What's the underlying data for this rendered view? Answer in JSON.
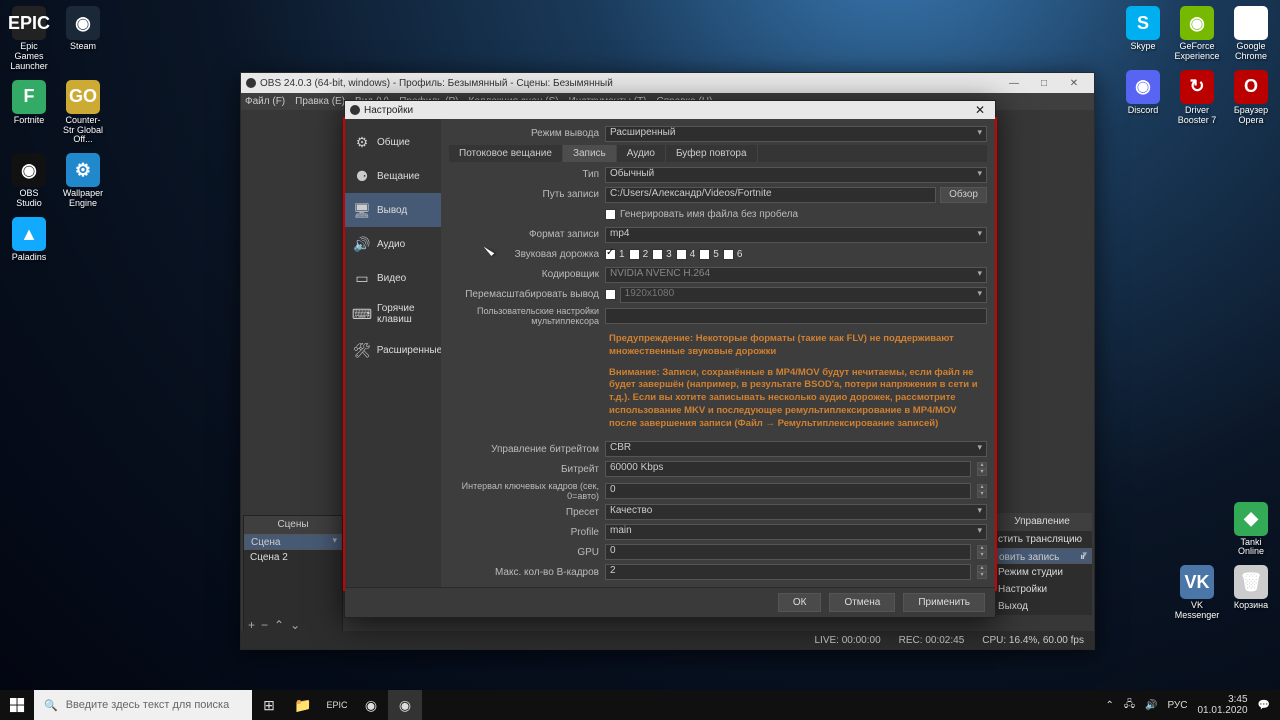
{
  "desktop": {
    "left": [
      [
        {
          "label": "Epic Games Launcher",
          "color": "#222",
          "text": "EPIC"
        },
        {
          "label": "Steam",
          "color": "#1b2838",
          "text": "◉"
        }
      ],
      [
        {
          "label": "Fortnite",
          "color": "#3a6",
          "text": "F"
        },
        {
          "label": "Counter-Str Global Off...",
          "color": "#ca3",
          "text": "GO"
        }
      ],
      [
        {
          "label": "OBS Studio",
          "color": "#111",
          "text": "◉"
        },
        {
          "label": "Wallpaper Engine",
          "color": "#28c",
          "text": "⚙"
        }
      ],
      [
        {
          "label": "Paladins",
          "color": "#1af",
          "text": "▲"
        }
      ]
    ],
    "right": [
      [
        {
          "label": "Skype",
          "color": "#00aff0",
          "text": "S"
        },
        {
          "label": "GeForce Experience",
          "color": "#76b900",
          "text": "◉"
        },
        {
          "label": "Google Chrome",
          "color": "#fff",
          "text": "◉"
        }
      ],
      [
        {
          "label": "Discord",
          "color": "#5865f2",
          "text": "◉"
        },
        {
          "label": "Driver Booster 7",
          "color": "#b00",
          "text": "↻"
        },
        {
          "label": "Браузер Opera",
          "color": "#b00",
          "text": "O"
        }
      ],
      [],
      [],
      [],
      [],
      [],
      [],
      [],
      [],
      [
        {
          "label": "Tanki Online",
          "color": "#3a5",
          "text": "◆"
        }
      ],
      [
        {
          "label": "VK Messenger",
          "color": "#4a76a8",
          "text": "VK"
        },
        {
          "label": "Корзина",
          "color": "#ccc",
          "text": "🗑"
        }
      ]
    ]
  },
  "obs": {
    "title": "OBS 24.0.3 (64-bit, windows) - Профиль: Безымянный - Сцены: Безымянный",
    "menu": [
      "Файл (F)",
      "Правка (E)",
      "Вид (V)",
      "Профиль (P)",
      "Коллекция сцен (S)",
      "Инструменты (T)",
      "Справка (H)"
    ],
    "scenesHdr": "Сцены",
    "scenes": [
      "Сцена",
      "Сцена 2"
    ],
    "controlsHdr": "Управление",
    "controls": [
      "стить трансляцию",
      "овить запись",
      "Режим студии",
      "Настройки",
      "Выход"
    ],
    "status": {
      "live": "LIVE: 00:00:00",
      "rec": "REC: 00:02:45",
      "cpu": "CPU: 16.4%, 60.00 fps"
    }
  },
  "settings": {
    "title": "Настройки",
    "categories": [
      {
        "icon": "⚙",
        "label": "Общие"
      },
      {
        "icon": "⚈",
        "label": "Вещание"
      },
      {
        "icon": "🖥",
        "label": "Вывод"
      },
      {
        "icon": "🔊",
        "label": "Аудио"
      },
      {
        "icon": "▭",
        "label": "Видео"
      },
      {
        "icon": "⌨",
        "label": "Горячие клавиш"
      },
      {
        "icon": "🛠",
        "label": "Расширенные"
      }
    ],
    "outputModeLabel": "Режим вывода",
    "outputMode": "Расширенный",
    "tabs": [
      "Потоковое вещание",
      "Запись",
      "Аудио",
      "Буфер повтора"
    ],
    "typeLabel": "Тип",
    "type": "Обычный",
    "recPathLabel": "Путь записи",
    "recPath": "C:/Users/Александр/Videos/Fortnite",
    "browse": "Обзор",
    "noSpaceLabel": "Генерировать имя файла без пробела",
    "recFormatLabel": "Формат записи",
    "recFormat": "mp4",
    "trackLabel": "Звуковая дорожка",
    "tracks": [
      "1",
      "2",
      "3",
      "4",
      "5",
      "6"
    ],
    "encoderLabel": "Кодировщик",
    "encoder": "NVIDIA NVENC H.264",
    "rescaleLabel": "Перемасштабировать вывод",
    "rescale": "1920x1080",
    "muxLabel": "Пользовательские настройки мультиплексора",
    "warn1": "Предупреждение: Некоторые форматы (такие как FLV) не поддерживают множественные звуковые дорожки",
    "warn2": "Внимание: Записи, сохранённые в MP4/MOV будут нечитаемы, если файл не будет завершён (например, в результате BSOD'а, потери напряжения в сети и т.д.). Если вы хотите записывать несколько аудио дорожек, рассмотрите использование MKV и последующее ремультиплексирование в MP4/MOV после завершения записи (Файл → Ремультиплексирование записей)",
    "rateCtrlLabel": "Управление битрейтом",
    "rateCtrl": "CBR",
    "bitrateLabel": "Битрейт",
    "bitrate": "60000 Kbps",
    "keyintLabel": "Интервал ключевых кадров (сек, 0=авто)",
    "keyint": "0",
    "presetLabel": "Пресет",
    "preset": "Качество",
    "profileLabel": "Profile",
    "profile": "main",
    "gpuLabel": "GPU",
    "gpu": "0",
    "bframesLabel": "Макс. кол-во B-кадров",
    "bframes": "2",
    "buttons": {
      "ok": "ОК",
      "cancel": "Отмена",
      "apply": "Применить"
    }
  },
  "taskbar": {
    "searchPlaceholder": "Введите здесь текст для поиска",
    "lang": "РУС",
    "time": "3:45",
    "date": "01.01.2020"
  }
}
